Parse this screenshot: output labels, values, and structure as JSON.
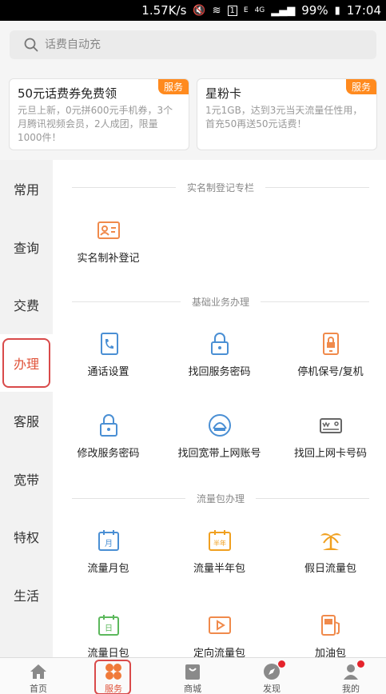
{
  "status_bar": {
    "speed": "1.57K/s",
    "battery": "99%",
    "time": "17:04",
    "network": "4G",
    "sim": "1",
    "signal_label": "E"
  },
  "search": {
    "placeholder": "话费自动充"
  },
  "promos": [
    {
      "title": "50元话费券免费领",
      "desc": "元旦上新，0元拼600元手机券，3个月腾讯视频会员，2人成团，限量1000件！",
      "tag": "服务"
    },
    {
      "title": "星粉卡",
      "desc": "1元1GB，达到3元当天流量任性用，首充50再送50元话费！",
      "tag": "服务"
    }
  ],
  "sidebar": {
    "items": [
      {
        "label": "常用"
      },
      {
        "label": "查询"
      },
      {
        "label": "交费"
      },
      {
        "label": "办理"
      },
      {
        "label": "客服"
      },
      {
        "label": "宽带"
      },
      {
        "label": "特权"
      },
      {
        "label": "生活"
      }
    ],
    "active": "办理"
  },
  "sections": [
    {
      "title": "实名制登记专栏",
      "items": [
        {
          "label": "实名制补登记",
          "icon": "id-card-icon"
        }
      ]
    },
    {
      "title": "基础业务办理",
      "items": [
        {
          "label": "通话设置",
          "icon": "phone-settings-icon"
        },
        {
          "label": "找回服务密码",
          "icon": "lock-icon"
        },
        {
          "label": "停机保号/复机",
          "icon": "phone-lock-icon"
        },
        {
          "label": "修改服务密码",
          "icon": "lock-icon"
        },
        {
          "label": "找回宽带上网账号",
          "icon": "broadband-icon"
        },
        {
          "label": "找回上网卡号码",
          "icon": "sim-card-icon"
        }
      ]
    },
    {
      "title": "流量包办理",
      "items": [
        {
          "label": "流量月包",
          "icon": "calendar-month-icon",
          "glyph": "月"
        },
        {
          "label": "流量半年包",
          "icon": "calendar-halfyear-icon",
          "glyph": "半年"
        },
        {
          "label": "假日流量包",
          "icon": "palm-tree-icon"
        },
        {
          "label": "流量日包",
          "icon": "calendar-day-icon",
          "glyph": "日"
        },
        {
          "label": "定向流量包",
          "icon": "video-play-icon"
        },
        {
          "label": "加油包",
          "icon": "fuel-icon"
        }
      ]
    }
  ],
  "tabbar": {
    "items": [
      {
        "label": "首页",
        "icon": "home-icon"
      },
      {
        "label": "服务",
        "icon": "service-clover-icon"
      },
      {
        "label": "商城",
        "icon": "shopping-bag-icon"
      },
      {
        "label": "发现",
        "icon": "compass-icon"
      },
      {
        "label": "我的",
        "icon": "user-icon"
      }
    ],
    "active": "服务"
  },
  "colors": {
    "accent_orange": "#ff8a1e",
    "active_red": "#e0533a",
    "highlight_border": "#d94a4a",
    "icon_blue": "#4a8fd4",
    "icon_orange": "#f08a4b",
    "notification_dot": "#e5232b"
  }
}
